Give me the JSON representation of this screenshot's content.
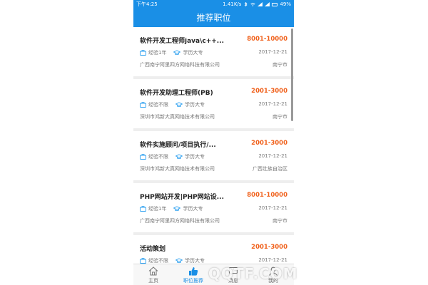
{
  "status": {
    "time": "下午4:25",
    "speed": "1.41K/s",
    "battery": "49%"
  },
  "header": {
    "title": "推荐职位"
  },
  "jobs": [
    {
      "title": "软件开发工程师java\\c++...",
      "salary": "8001-10000",
      "experience": "经验1年",
      "education": "学历大专",
      "date": "2017-12-21",
      "company": "广西南宁阿里四方网络科技有限公司",
      "location": "南宁市"
    },
    {
      "title": "软件开发助理工程师(PB)",
      "salary": "2001-3000",
      "experience": "经验不限",
      "education": "学历大专",
      "date": "2017-12-21",
      "company": "深圳市鸿新大真网络技术有限公司",
      "location": "南宁市"
    },
    {
      "title": "软件实施顾问/项目执行/...",
      "salary": "2001-3000",
      "experience": "经验不限",
      "education": "学历大专",
      "date": "2017-12-21",
      "company": "深圳市鸿新大真网络技术有限公司",
      "location": "广西壮族自治区"
    },
    {
      "title": "PHP网站开发|PHP网站设...",
      "salary": "8001-10000",
      "experience": "经验1年",
      "education": "学历大专",
      "date": "2017-12-21",
      "company": "广西南宁阿里四方网络科技有限公司",
      "location": "南宁市"
    },
    {
      "title": "活动策划",
      "salary": "2001-3000",
      "experience": "经验不限",
      "education": "学历大专",
      "date": "2017-12-21",
      "company": "",
      "location": ""
    }
  ],
  "tabs": [
    {
      "label": "主页"
    },
    {
      "label": "职位推荐"
    },
    {
      "label": "消息"
    },
    {
      "label": "我的"
    }
  ],
  "watermark": "QQTF.COM",
  "colors": {
    "accent": "#1a8fe6",
    "salary": "#f0621d"
  }
}
